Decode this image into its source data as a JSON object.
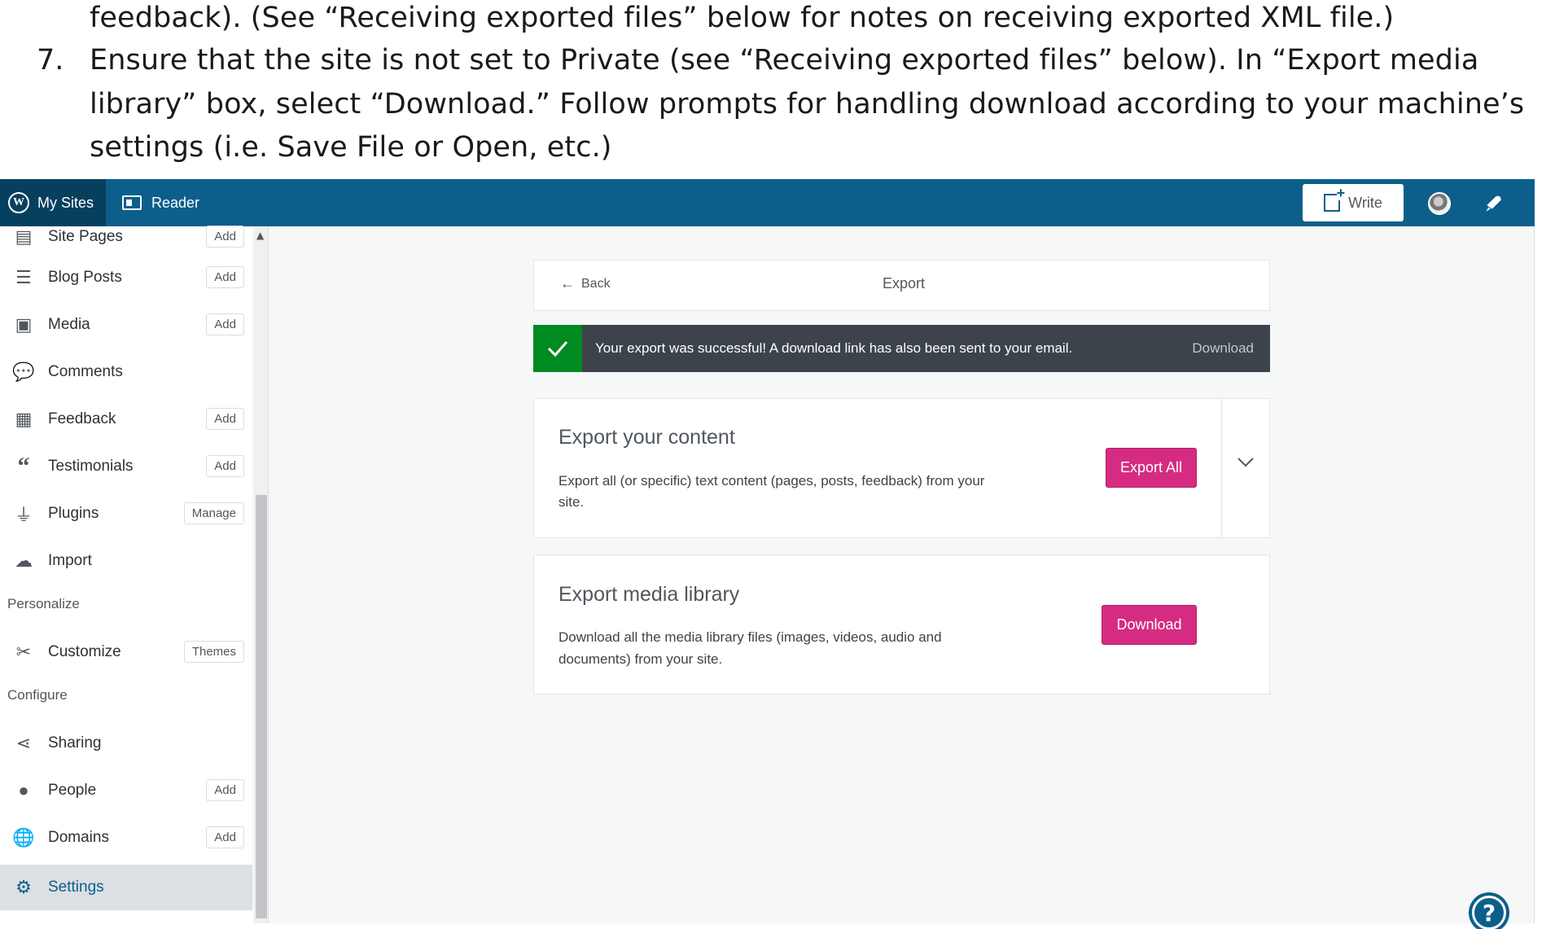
{
  "doc": {
    "line1": "feedback). (See “Receiving exported files” below for notes on receiving exported XML file.)",
    "step_number": "7.",
    "line2": "Ensure that the site is not set to Private (see “Receiving exported files” below). In “Export media",
    "line3": "library” box, select “Download.” Follow prompts for handling download according to your machine’s",
    "line4": "settings (i.e. Save File or Open, etc.)"
  },
  "topbar": {
    "my_sites": "My Sites",
    "reader": "Reader",
    "write": "Write"
  },
  "sidebar": {
    "items": [
      {
        "label": "Site Pages",
        "badge": "Add"
      },
      {
        "label": "Blog Posts",
        "badge": "Add"
      },
      {
        "label": "Media",
        "badge": "Add"
      },
      {
        "label": "Comments",
        "badge": ""
      },
      {
        "label": "Feedback",
        "badge": "Add"
      },
      {
        "label": "Testimonials",
        "badge": "Add"
      },
      {
        "label": "Plugins",
        "badge": "Manage"
      },
      {
        "label": "Import",
        "badge": ""
      }
    ],
    "personalize_heading": "Personalize",
    "personalize_items": [
      {
        "label": "Customize",
        "badge": "Themes"
      }
    ],
    "configure_heading": "Configure",
    "configure_items": [
      {
        "label": "Sharing",
        "badge": ""
      },
      {
        "label": "People",
        "badge": "Add"
      },
      {
        "label": "Domains",
        "badge": "Add"
      },
      {
        "label": "Settings",
        "badge": ""
      }
    ]
  },
  "header": {
    "back": "Back",
    "title": "Export"
  },
  "notice": {
    "message": "Your export was successful! A download link has also been sent to your email.",
    "action": "Download"
  },
  "export_content": {
    "title": "Export your content",
    "desc_line1": "Export all (or specific) text content (pages, posts, feedback) from your",
    "desc_line2": "site.",
    "button": "Export All"
  },
  "export_media": {
    "title": "Export media library",
    "desc_line1": "Download all the media library files (images, videos, audio and",
    "desc_line2": "documents) from your site.",
    "button": "Download"
  },
  "colors": {
    "topbar": "#0b5f8a",
    "accent_pink": "#d52c82",
    "success_green": "#008a20"
  }
}
